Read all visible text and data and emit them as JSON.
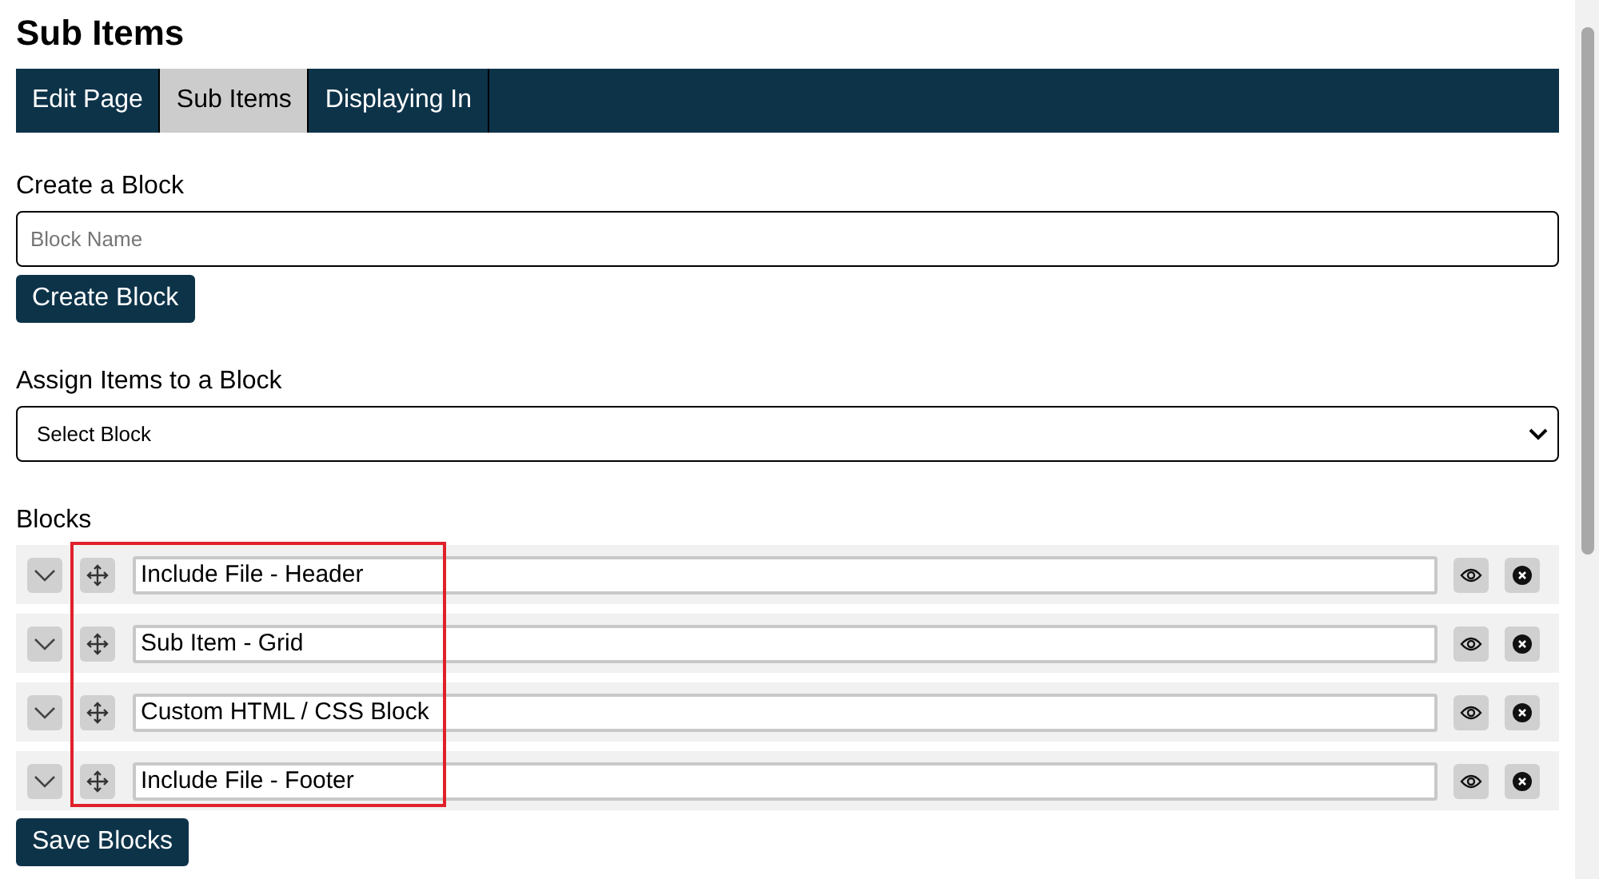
{
  "title": "Sub Items",
  "tabs": [
    {
      "label": "Edit Page",
      "selected": false
    },
    {
      "label": "Sub Items",
      "selected": true
    },
    {
      "label": "Displaying In",
      "selected": false
    }
  ],
  "create": {
    "label": "Create a Block",
    "placeholder": "Block Name",
    "button": "Create Block"
  },
  "assign": {
    "label": "Assign Items to a Block",
    "select": "Select Block"
  },
  "blocks": {
    "label": "Blocks",
    "items": [
      {
        "name": "Include File - Header"
      },
      {
        "name": "Sub Item - Grid"
      },
      {
        "name": "Custom HTML / CSS Block"
      },
      {
        "name": "Include File - Footer"
      }
    ],
    "button": "Save Blocks"
  }
}
